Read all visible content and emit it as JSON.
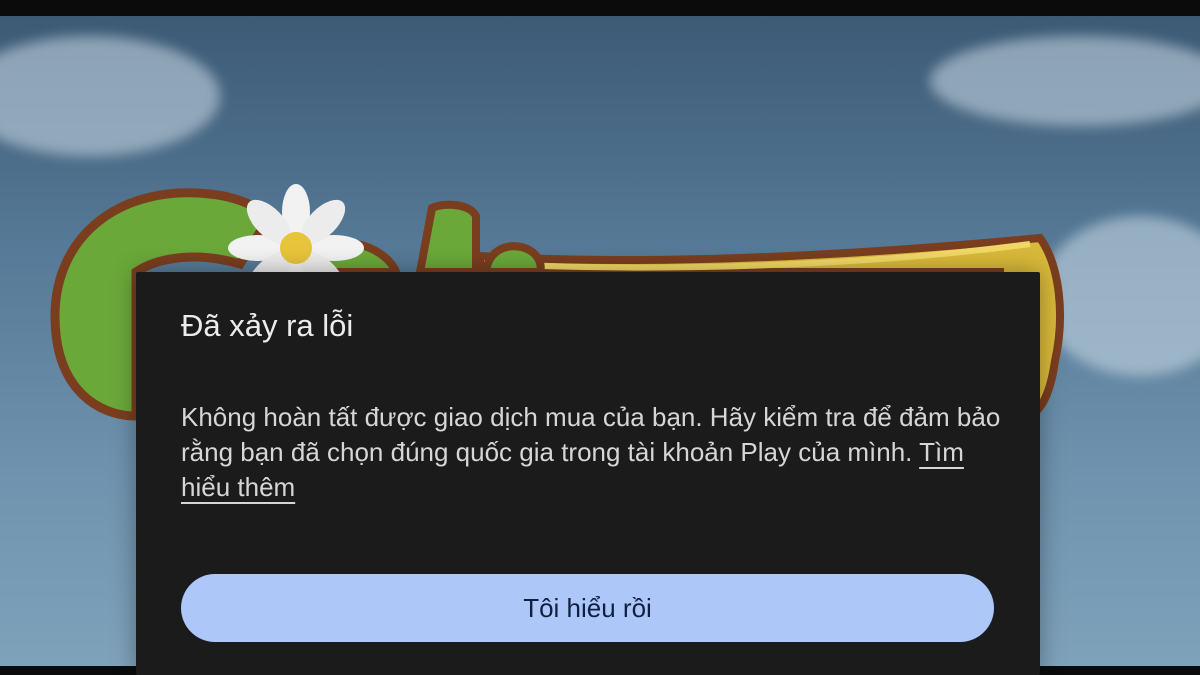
{
  "background": {
    "description_icon": "game-logo-with-daisy",
    "sky_color": "#557996"
  },
  "dialog": {
    "title": "Đã xảy ra lỗi",
    "message": "Không hoàn tất được giao dịch mua của bạn. Hãy kiểm tra để đảm bảo rằng bạn đã chọn đúng quốc gia trong tài khoản Play của mình.",
    "learn_more": "Tìm hiểu thêm",
    "confirm_label": "Tôi hiểu rồi",
    "background_color": "#1b1b1c",
    "button_color": "#adc7f9"
  }
}
